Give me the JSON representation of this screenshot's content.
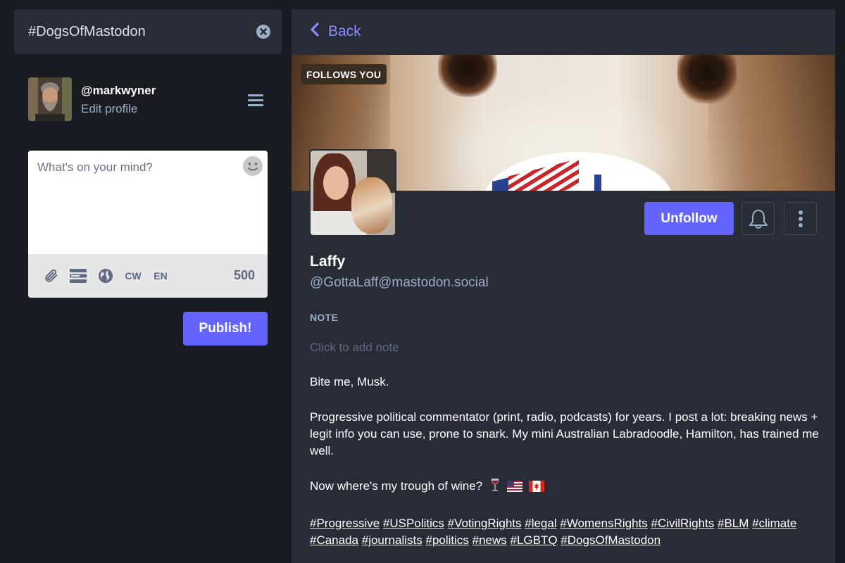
{
  "search": {
    "value": "#DogsOfMastodon"
  },
  "account": {
    "handle": "@markwyner",
    "edit_label": "Edit profile"
  },
  "compose": {
    "placeholder": "What's on your mind?",
    "tools": {
      "cw": "CW",
      "lang": "EN"
    },
    "char_count": "500",
    "publish_label": "Publish!"
  },
  "profile": {
    "back_label": "Back",
    "follows_badge": "FOLLOWS YOU",
    "unfollow_label": "Unfollow",
    "display_name": "Laffy",
    "acct": "@GottaLaff@mastodon.social",
    "note_label": "NOTE",
    "note_placeholder": "Click to add note",
    "bio": {
      "line1": "Bite me, Musk.",
      "line2": "Progressive political commentator (print, radio, podcasts) for years. I post a lot: breaking news + legit info you can use, prone to snark. My mini Australian Labradoodle, Hamilton, has trained me well.",
      "line3": "Now where's my trough of wine?",
      "hashtags": [
        "#Progressive",
        "#USPolitics",
        "#VotingRights",
        "#legal",
        "#WomensRights",
        "#CivilRights",
        "#BLM",
        "#climate",
        "#Canada",
        "#journalists",
        "#politics",
        "#news",
        "#LGBTQ",
        "#DogsOfMastodon"
      ]
    }
  },
  "icons": {
    "search_clear": "close-circle-icon",
    "menu": "hamburger-menu-icon",
    "emoji": "emoji-smile-icon",
    "attach": "paperclip-icon",
    "poll": "poll-icon",
    "visibility": "globe-icon",
    "back": "chevron-left-icon",
    "notify": "bell-icon",
    "more": "vertical-ellipsis-icon",
    "wine": "wine-glass-icon",
    "flag_us": "us-flag-icon",
    "flag_ca": "canada-flag-icon"
  },
  "colors": {
    "accent": "#6364ff",
    "background": "#191b22",
    "panel": "#282c37",
    "secondary_text": "#9baec8",
    "link": "#8c8dff"
  }
}
